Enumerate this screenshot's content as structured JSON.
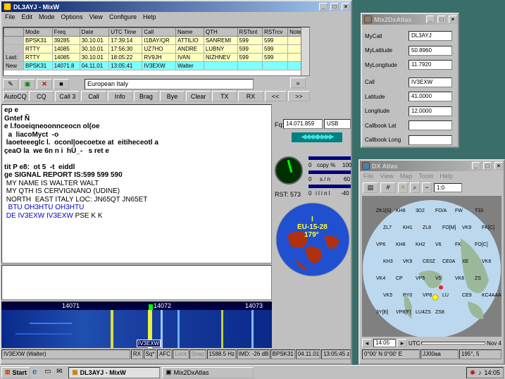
{
  "mixw": {
    "title": "DL3AYJ - MixW",
    "menu": [
      "File",
      "Edit",
      "Mode",
      "Options",
      "View",
      "Configure",
      "Help"
    ],
    "log_headers": [
      "Mode",
      "Freq",
      "Date",
      "UTC Time",
      "Call",
      "Name",
      "QTH",
      "RSTsnt",
      "RSTrcv",
      "Notes"
    ],
    "log_rows": [
      {
        "tag": "",
        "bg": "#ffffc0",
        "cells": [
          "BPSK31",
          "39285",
          "30.10.01",
          "17:39:14",
          "I1BAY/QR",
          "ATTILIO",
          "SANREMI",
          "599",
          "599",
          ""
        ]
      },
      {
        "tag": "",
        "bg": "#ffffc0",
        "cells": [
          "RTTY",
          "14085",
          "30.10.01",
          "17:56:30",
          "UZ7HO",
          "ANDRE",
          "LUBNY",
          "599",
          "599",
          ""
        ]
      },
      {
        "tag": "Last:",
        "bg": "#ffffc0",
        "cells": [
          "RTTY",
          "14085",
          "30.10.01",
          "18:05:22",
          "RV9JH",
          "IVAN",
          "NIZHNEV",
          "599",
          "599",
          ""
        ]
      },
      {
        "tag": "New",
        "bg": "#80ffff",
        "cells": [
          "BPSK31",
          "14071.8",
          "04.11.01",
          "13:05:41",
          "IV3EXW",
          "Walter",
          "",
          "",
          "",
          ""
        ]
      }
    ],
    "info_field": "European Italy",
    "macro_buttons": [
      "AutoCQ",
      "CQ",
      "Call 3",
      "Call",
      "Info",
      "Brag",
      "Bye",
      "Clear",
      "TX",
      "RX",
      "<<",
      ">>"
    ],
    "rx_lines": [
      {
        "t": "ep e",
        "c": "b"
      },
      {
        "t": "Gntef Ñ",
        "c": "b"
      },
      {
        "t": "e l.fooeiqneoonnceocn ol(oe",
        "c": "b"
      },
      {
        "t": "  a  liacoMyct  -o",
        "c": "b"
      },
      {
        "t": " laoeteeeglc l.  oconl|oecoetxe at  eitiheceotl a",
        "c": "b"
      },
      {
        "t": "çeaO la  we 6n n i  hÜ_-   s ret e",
        "c": "b"
      },
      {
        "t": "",
        "c": ""
      },
      {
        "t": "tit P e8:  ot 5  -t  eiddl",
        "c": "b"
      },
      {
        "t": "ge SIGNAL REPORT IS:599 599 590",
        "c": "b"
      },
      {
        "t": " MY NAME IS WALTER WALT",
        "c": ""
      },
      {
        "t": " MY QTH IS CERVIGNANO (UDINE)",
        "c": ""
      },
      {
        "t": " NORTH  EAST ITALY LOC: JN65QT JN65ET",
        "c": ""
      },
      {
        "t": "  BTU OH3HTU OH3HTU",
        "c": "blue"
      },
      {
        "t": " DE IV3EXW IV3EXW PSE K K",
        "c": "mix"
      }
    ],
    "freq_value": "14.071.859",
    "mode_value": "USB",
    "freq_label": "Fq:",
    "copy_pct": "0",
    "copy_label": "copy %",
    "copy_max": "100",
    "sn_min": "0",
    "sn_label": "s / n",
    "sn_max": "60",
    "level_min": "0",
    "level_label": "i  l  i  n  l",
    "level_max": "-40",
    "rst_label": "RST: 573",
    "globe_prefix": "I",
    "globe_zone": "EU-15-28",
    "globe_bearing": "179°",
    "waterfall_ticks": [
      "14071",
      "14072",
      "14073"
    ],
    "waterfall_call": "IV3EXW",
    "status_items": [
      "IV3EXW (Walter)",
      "RX",
      "Sq*",
      "AFC",
      "Lock",
      "Snap",
      "1588.5 Hz",
      "IMD: -26 dB",
      "BPSK31",
      "04.11.01",
      "13:05:45 z"
    ]
  },
  "mix2dx": {
    "title": "Mix2DxAtlas",
    "fields": [
      {
        "label": "MyCall",
        "value": "DL3AYJ"
      },
      {
        "label": "MyLatitude",
        "value": "50.8960"
      },
      {
        "label": "MyLongitude",
        "value": "11.7920"
      },
      {
        "label": "Call",
        "value": "IV3EXW"
      },
      {
        "label": "Latitude",
        "value": "41.0000"
      },
      {
        "label": "Longitude",
        "value": "12.0000"
      },
      {
        "label": "Callbook Lat",
        "value": ""
      },
      {
        "label": "Callbook Long",
        "value": ""
      }
    ]
  },
  "dxatlas": {
    "title": "DX Atlas",
    "menu": [
      "File",
      "View",
      "Map",
      "Tools",
      "Help"
    ],
    "zoom": "1:0",
    "prefixes": [
      "ZK1[S]",
      "KH8",
      "3D2",
      "FO/A",
      "FW",
      "T33",
      "ZL7",
      "KH1",
      "ZL8",
      "FO[M]",
      "VK9",
      "FK[C]",
      "VP6",
      "KH8",
      "KH2",
      "V6",
      "FK",
      "FO[C]",
      "KH3",
      "VK9",
      "CE0Z",
      "CE0A",
      "XE",
      "VK8",
      "VK4",
      "CP",
      "VP5",
      "V5",
      "VK6",
      "ZS",
      "VK5",
      "PY0",
      "VP8",
      "LU",
      "CE9",
      "KC4AAA",
      "3Y[B]",
      "VP8[F]",
      "LU4ZS",
      "ZS8"
    ],
    "time": "14:05",
    "date": "Nov 4",
    "utc": "UTC",
    "status_coords": "0°00' N  0°00' E",
    "status_loc": "JJ00aa",
    "status_bearing": "195°, 5"
  },
  "taskbar": {
    "start": "Start",
    "items": [
      "DL3AYJ - MixW",
      "Mix2DxAtlas"
    ],
    "clock": "14:05"
  }
}
